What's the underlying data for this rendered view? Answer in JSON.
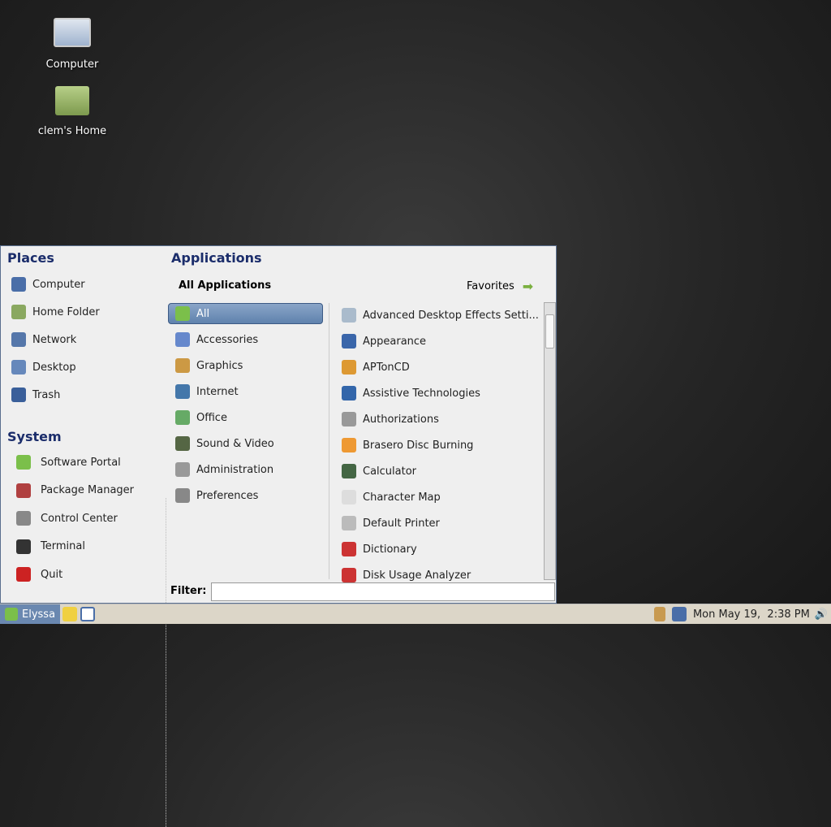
{
  "desktop": {
    "icons": [
      {
        "label": "Computer"
      },
      {
        "label": "clem's Home"
      }
    ]
  },
  "menu": {
    "places_title": "Places",
    "places": [
      {
        "label": "Computer",
        "color": "#4a6ea8"
      },
      {
        "label": "Home Folder",
        "color": "#8aa860"
      },
      {
        "label": "Network",
        "color": "#5577aa"
      },
      {
        "label": "Desktop",
        "color": "#6688bb"
      },
      {
        "label": "Trash",
        "color": "#3a5f9a"
      }
    ],
    "system_title": "System",
    "system": [
      {
        "label": "Software Portal",
        "color": "#7bbf4a"
      },
      {
        "label": "Package Manager",
        "color": "#b04040"
      },
      {
        "label": "Control Center",
        "color": "#888888"
      },
      {
        "label": "Terminal",
        "color": "#333333"
      },
      {
        "label": "Quit",
        "color": "#cc2222"
      }
    ],
    "apps_title": "Applications",
    "all_apps_label": "All Applications",
    "favorites_label": "Favorites",
    "categories": [
      {
        "label": "All",
        "color": "#7bbf4a"
      },
      {
        "label": "Accessories",
        "color": "#6688cc"
      },
      {
        "label": "Graphics",
        "color": "#cc9944"
      },
      {
        "label": "Internet",
        "color": "#4477aa"
      },
      {
        "label": "Office",
        "color": "#66aa66"
      },
      {
        "label": "Sound & Video",
        "color": "#556644"
      },
      {
        "label": "Administration",
        "color": "#999999"
      },
      {
        "label": "Preferences",
        "color": "#888888"
      }
    ],
    "apps": [
      {
        "label": "Advanced Desktop Effects Setti...",
        "color": "#aabbcc"
      },
      {
        "label": "Appearance",
        "color": "#3a66aa"
      },
      {
        "label": "APTonCD",
        "color": "#dd9933"
      },
      {
        "label": "Assistive Technologies",
        "color": "#3366aa"
      },
      {
        "label": "Authorizations",
        "color": "#999999"
      },
      {
        "label": "Brasero Disc Burning",
        "color": "#ee9933"
      },
      {
        "label": "Calculator",
        "color": "#446644"
      },
      {
        "label": "Character Map",
        "color": "#dddddd"
      },
      {
        "label": "Default Printer",
        "color": "#bbbbbb"
      },
      {
        "label": "Dictionary",
        "color": "#cc3333"
      },
      {
        "label": "Disk Usage Analyzer",
        "color": "#cc3333"
      }
    ],
    "filter_label": "Filter:",
    "filter_value": ""
  },
  "taskbar": {
    "menu_label": "Elyssa",
    "clock": "Mon May 19,  2:38 PM"
  }
}
